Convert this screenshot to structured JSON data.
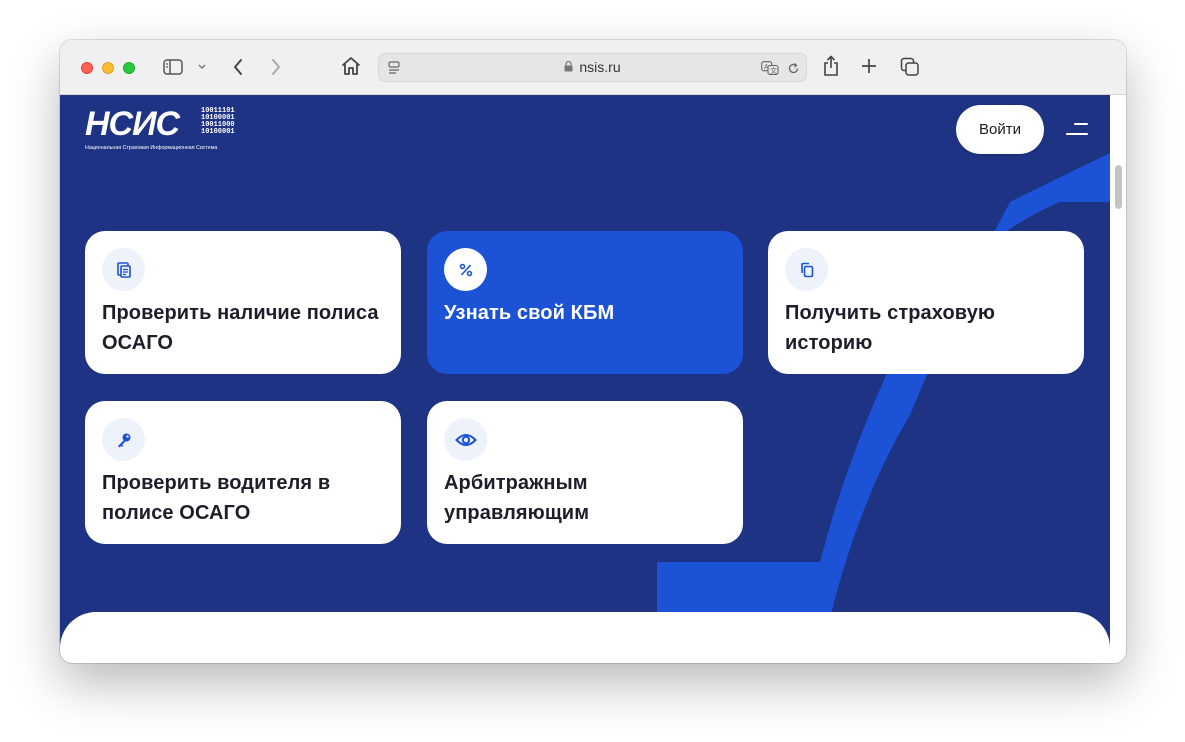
{
  "browser": {
    "url": "nsis.ru"
  },
  "header": {
    "logo_text": "НСИС",
    "logo_bits": "10011101\n10100001\n10011000\n10100001",
    "logo_subtitle": "Национальная Страховая Информационная Система",
    "login_label": "Войти"
  },
  "cards": [
    {
      "title": "Проверить наличие полиса ОСАГО",
      "icon": "document-list-icon"
    },
    {
      "title": "Узнать свой КБМ",
      "icon": "percent-icon",
      "active": true
    },
    {
      "title": "Получить страховую историю",
      "icon": "copy-documents-icon"
    },
    {
      "title": "Проверить водителя в полисе ОСАГО",
      "icon": "key-icon"
    },
    {
      "title": "Арбитражным управляющим",
      "icon": "eye-icon"
    }
  ],
  "colors": {
    "page_bg": "#1e3384",
    "accent": "#1b52d6",
    "card_bg": "#ffffff",
    "icon_blue": "#1b52d6"
  }
}
